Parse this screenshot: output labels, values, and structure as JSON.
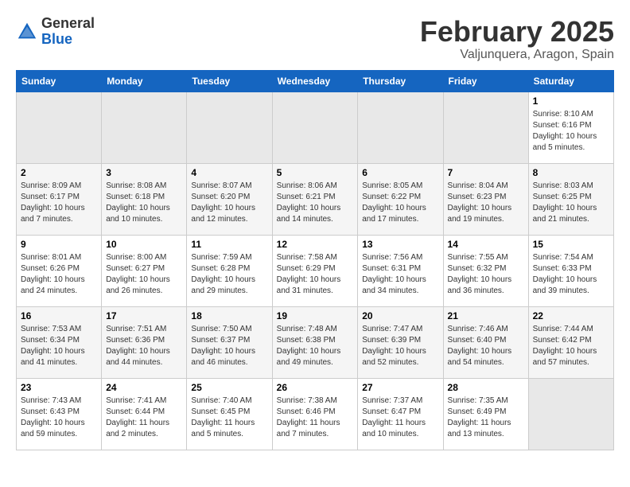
{
  "header": {
    "logo_general": "General",
    "logo_blue": "Blue",
    "month_title": "February 2025",
    "location": "Valjunquera, Aragon, Spain"
  },
  "weekdays": [
    "Sunday",
    "Monday",
    "Tuesday",
    "Wednesday",
    "Thursday",
    "Friday",
    "Saturday"
  ],
  "weeks": [
    [
      {
        "day": "",
        "info": ""
      },
      {
        "day": "",
        "info": ""
      },
      {
        "day": "",
        "info": ""
      },
      {
        "day": "",
        "info": ""
      },
      {
        "day": "",
        "info": ""
      },
      {
        "day": "",
        "info": ""
      },
      {
        "day": "1",
        "info": "Sunrise: 8:10 AM\nSunset: 6:16 PM\nDaylight: 10 hours and 5 minutes."
      }
    ],
    [
      {
        "day": "2",
        "info": "Sunrise: 8:09 AM\nSunset: 6:17 PM\nDaylight: 10 hours and 7 minutes."
      },
      {
        "day": "3",
        "info": "Sunrise: 8:08 AM\nSunset: 6:18 PM\nDaylight: 10 hours and 10 minutes."
      },
      {
        "day": "4",
        "info": "Sunrise: 8:07 AM\nSunset: 6:20 PM\nDaylight: 10 hours and 12 minutes."
      },
      {
        "day": "5",
        "info": "Sunrise: 8:06 AM\nSunset: 6:21 PM\nDaylight: 10 hours and 14 minutes."
      },
      {
        "day": "6",
        "info": "Sunrise: 8:05 AM\nSunset: 6:22 PM\nDaylight: 10 hours and 17 minutes."
      },
      {
        "day": "7",
        "info": "Sunrise: 8:04 AM\nSunset: 6:23 PM\nDaylight: 10 hours and 19 minutes."
      },
      {
        "day": "8",
        "info": "Sunrise: 8:03 AM\nSunset: 6:25 PM\nDaylight: 10 hours and 21 minutes."
      }
    ],
    [
      {
        "day": "9",
        "info": "Sunrise: 8:01 AM\nSunset: 6:26 PM\nDaylight: 10 hours and 24 minutes."
      },
      {
        "day": "10",
        "info": "Sunrise: 8:00 AM\nSunset: 6:27 PM\nDaylight: 10 hours and 26 minutes."
      },
      {
        "day": "11",
        "info": "Sunrise: 7:59 AM\nSunset: 6:28 PM\nDaylight: 10 hours and 29 minutes."
      },
      {
        "day": "12",
        "info": "Sunrise: 7:58 AM\nSunset: 6:29 PM\nDaylight: 10 hours and 31 minutes."
      },
      {
        "day": "13",
        "info": "Sunrise: 7:56 AM\nSunset: 6:31 PM\nDaylight: 10 hours and 34 minutes."
      },
      {
        "day": "14",
        "info": "Sunrise: 7:55 AM\nSunset: 6:32 PM\nDaylight: 10 hours and 36 minutes."
      },
      {
        "day": "15",
        "info": "Sunrise: 7:54 AM\nSunset: 6:33 PM\nDaylight: 10 hours and 39 minutes."
      }
    ],
    [
      {
        "day": "16",
        "info": "Sunrise: 7:53 AM\nSunset: 6:34 PM\nDaylight: 10 hours and 41 minutes."
      },
      {
        "day": "17",
        "info": "Sunrise: 7:51 AM\nSunset: 6:36 PM\nDaylight: 10 hours and 44 minutes."
      },
      {
        "day": "18",
        "info": "Sunrise: 7:50 AM\nSunset: 6:37 PM\nDaylight: 10 hours and 46 minutes."
      },
      {
        "day": "19",
        "info": "Sunrise: 7:48 AM\nSunset: 6:38 PM\nDaylight: 10 hours and 49 minutes."
      },
      {
        "day": "20",
        "info": "Sunrise: 7:47 AM\nSunset: 6:39 PM\nDaylight: 10 hours and 52 minutes."
      },
      {
        "day": "21",
        "info": "Sunrise: 7:46 AM\nSunset: 6:40 PM\nDaylight: 10 hours and 54 minutes."
      },
      {
        "day": "22",
        "info": "Sunrise: 7:44 AM\nSunset: 6:42 PM\nDaylight: 10 hours and 57 minutes."
      }
    ],
    [
      {
        "day": "23",
        "info": "Sunrise: 7:43 AM\nSunset: 6:43 PM\nDaylight: 10 hours and 59 minutes."
      },
      {
        "day": "24",
        "info": "Sunrise: 7:41 AM\nSunset: 6:44 PM\nDaylight: 11 hours and 2 minutes."
      },
      {
        "day": "25",
        "info": "Sunrise: 7:40 AM\nSunset: 6:45 PM\nDaylight: 11 hours and 5 minutes."
      },
      {
        "day": "26",
        "info": "Sunrise: 7:38 AM\nSunset: 6:46 PM\nDaylight: 11 hours and 7 minutes."
      },
      {
        "day": "27",
        "info": "Sunrise: 7:37 AM\nSunset: 6:47 PM\nDaylight: 11 hours and 10 minutes."
      },
      {
        "day": "28",
        "info": "Sunrise: 7:35 AM\nSunset: 6:49 PM\nDaylight: 11 hours and 13 minutes."
      },
      {
        "day": "",
        "info": ""
      }
    ]
  ]
}
